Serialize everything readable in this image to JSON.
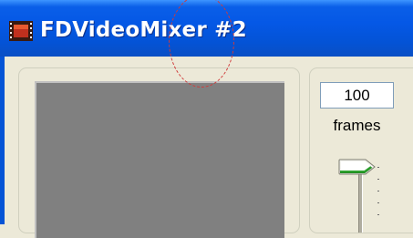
{
  "window": {
    "title": "FDVideoMixer #2",
    "icon": "filmstrip-icon"
  },
  "controls": {
    "frames_value": "100",
    "frames_label": "frames",
    "slider_position": 0
  },
  "colors": {
    "titlebar": "#0558e6",
    "client": "#ece9d8",
    "video": "#808080",
    "annotation": "#d03a3a"
  }
}
